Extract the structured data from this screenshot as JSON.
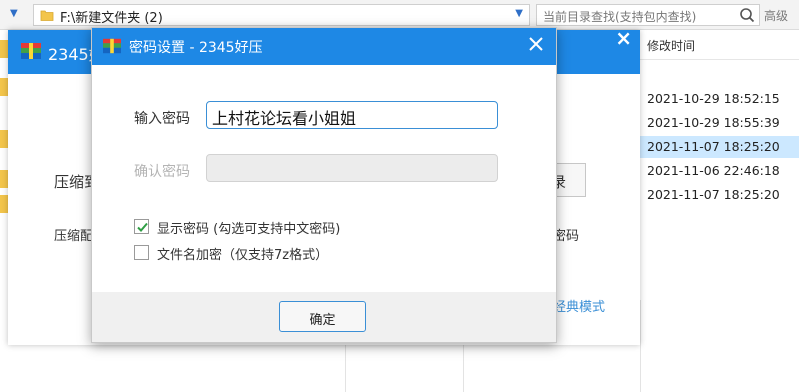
{
  "explorer": {
    "address": "F:\\新建文件夹 (2)",
    "search_placeholder": "当前目录查找(支持包内查找)",
    "advanced_label": "高级",
    "column_header": "修改时间",
    "rows": [
      {
        "modified": "2021-10-29 18:52:15"
      },
      {
        "modified": "2021-10-29 18:55:39"
      },
      {
        "modified": "2021-11-07 18:25:20"
      },
      {
        "modified": "2021-11-06 22:46:18"
      },
      {
        "modified": "2021-11-07 18:25:20"
      }
    ],
    "selected_row_index": 2
  },
  "compress_window": {
    "title": "2345好",
    "label_a": "压缩到",
    "label_b": "压缩配",
    "browse_label": "录",
    "password_right": "密码",
    "classic_mode": "经典模式"
  },
  "dialog": {
    "title": "密码设置 - 2345好压",
    "password_label": "输入密码",
    "password_value": "上村花论坛看小姐姐",
    "confirm_label": "确认密码",
    "confirm_value": "",
    "show_password_label": "显示密码 (勾选可支持中文密码)",
    "show_password_checked": true,
    "encrypt_names_label": "文件名加密（仅支持7z格式）",
    "encrypt_names_checked": false,
    "ok_label": "确定"
  },
  "colors": {
    "accent": "#1e88e5",
    "selection": "#cce8ff",
    "link": "#3a8fd6"
  }
}
